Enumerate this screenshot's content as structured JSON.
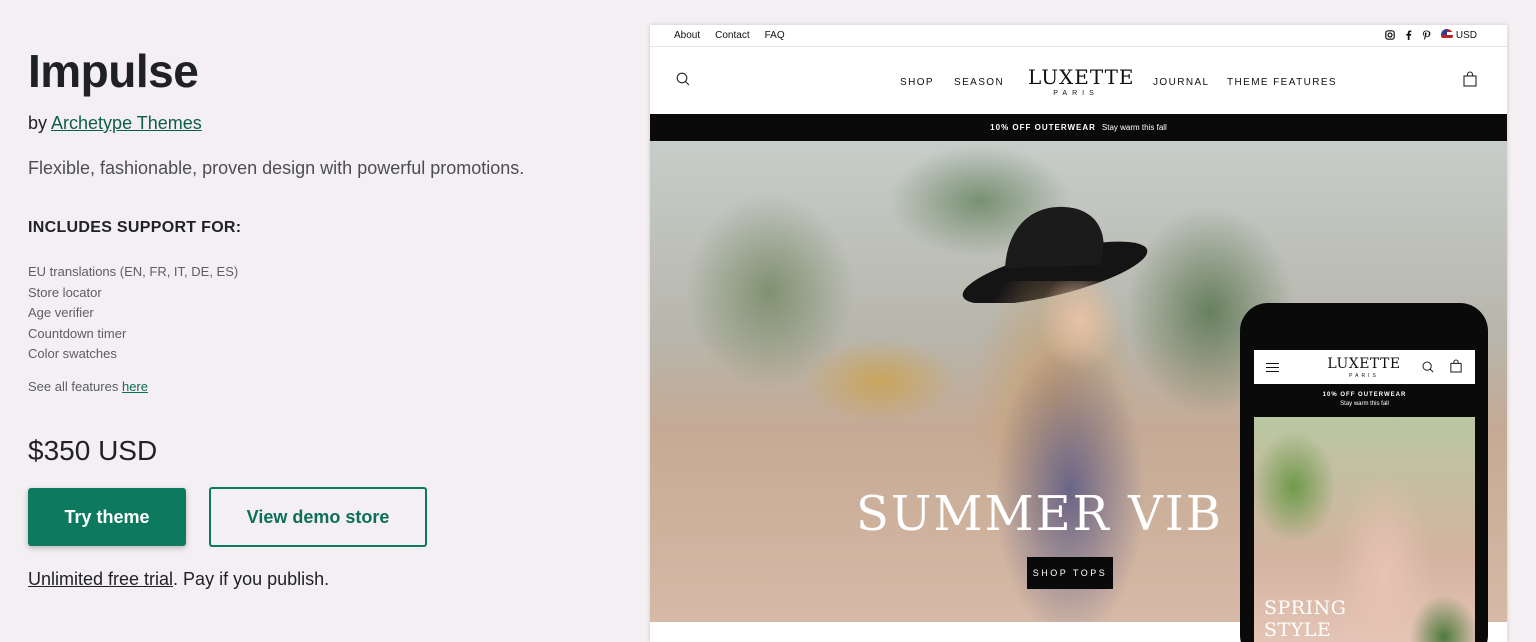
{
  "app": {
    "title": "Impulse",
    "by_prefix": "by",
    "author": "Archetype Themes",
    "tagline": "Flexible, fashionable, proven design with powerful promotions."
  },
  "support": {
    "heading": "INCLUDES SUPPORT FOR:",
    "features": [
      "EU translations (EN, FR, IT, DE, ES)",
      "Store locator",
      "Age verifier",
      "Countdown timer",
      "Color swatches"
    ],
    "see_all_prefix": "See all features",
    "see_all_link": "here"
  },
  "pricing": {
    "price": "$350 USD",
    "try_button": "Try theme",
    "demo_button": "View demo store",
    "trial_link": "Unlimited free trial",
    "trial_suffix": ". Pay if you publish."
  },
  "preview": {
    "util_links": [
      "About",
      "Contact",
      "FAQ"
    ],
    "currency": "USD",
    "nav_left": [
      "SHOP",
      "SEASON"
    ],
    "nav_right": [
      "JOURNAL",
      "THEME FEATURES"
    ],
    "logo": "LUXETTE",
    "logo_sub": "PARIS",
    "promo_bold": "10% OFF OUTERWEAR",
    "promo_text": "Stay warm this fall",
    "hero_text": "SUMMER VIB",
    "hero_button": "SHOP TOPS",
    "icons": [
      "search-icon",
      "cart-icon",
      "instagram-icon",
      "facebook-icon",
      "pinterest-icon",
      "us-flag-icon"
    ]
  },
  "phone": {
    "logo": "LUXETTE",
    "logo_sub": "PARIS",
    "promo_bold": "10% OFF OUTERWEAR",
    "promo_text": "Stay warm this fall",
    "hero_text": "SPRING\nSTYLE"
  },
  "colors": {
    "accent": "#0d7a5f",
    "background": "#f4eff3"
  }
}
